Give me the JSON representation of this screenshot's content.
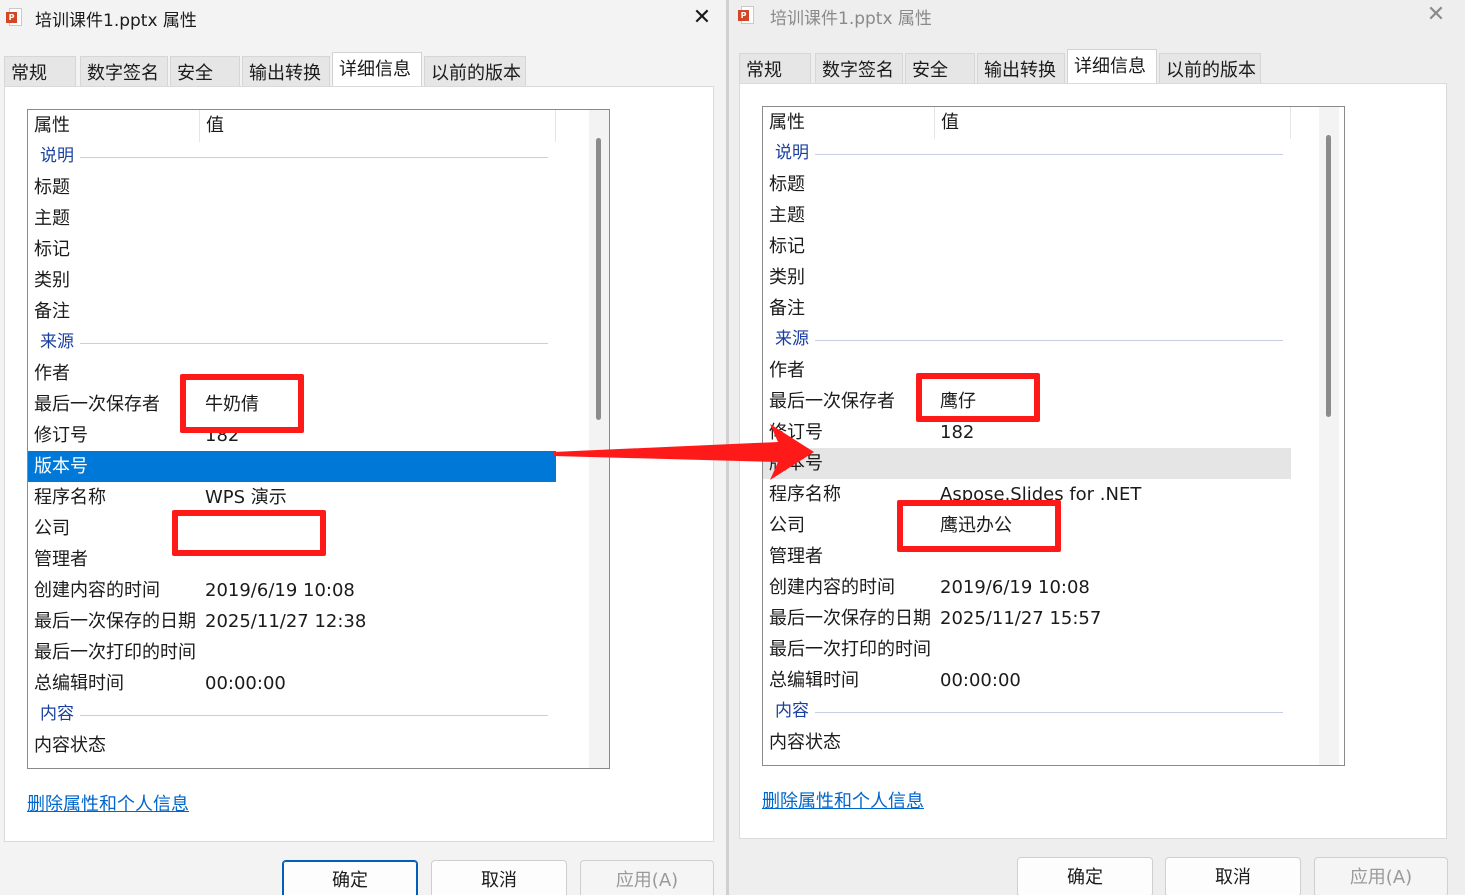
{
  "dialogs": [
    {
      "id": "left",
      "title": "培训课件1.pptx 属性",
      "tabs": [
        "常规",
        "数字签名",
        "安全",
        "输出转换",
        "详细信息",
        "以前的版本"
      ],
      "active_tab": "详细信息",
      "columns": {
        "property": "属性",
        "value": "值"
      },
      "rows": [
        {
          "kind": "group",
          "name": "说明"
        },
        {
          "kind": "prop",
          "name": "标题",
          "value": ""
        },
        {
          "kind": "prop",
          "name": "主题",
          "value": ""
        },
        {
          "kind": "prop",
          "name": "标记",
          "value": ""
        },
        {
          "kind": "prop",
          "name": "类别",
          "value": ""
        },
        {
          "kind": "prop",
          "name": "备注",
          "value": ""
        },
        {
          "kind": "group",
          "name": "来源"
        },
        {
          "kind": "prop",
          "name": "作者",
          "value": ""
        },
        {
          "kind": "prop",
          "name": "最后一次保存者",
          "value": "牛奶倩"
        },
        {
          "kind": "prop",
          "name": "修订号",
          "value": "182"
        },
        {
          "kind": "prop",
          "name": "版本号",
          "value": "",
          "state": "selected"
        },
        {
          "kind": "prop",
          "name": "程序名称",
          "value": "WPS 演示"
        },
        {
          "kind": "prop",
          "name": "公司",
          "value": ""
        },
        {
          "kind": "prop",
          "name": "管理者",
          "value": ""
        },
        {
          "kind": "prop",
          "name": "创建内容的时间",
          "value": "2019/6/19 10:08"
        },
        {
          "kind": "prop",
          "name": "最后一次保存的日期",
          "value": "2025/11/27 12:38"
        },
        {
          "kind": "prop",
          "name": "最后一次打印的时间",
          "value": ""
        },
        {
          "kind": "prop",
          "name": "总编辑时间",
          "value": "00:00:00"
        },
        {
          "kind": "group",
          "name": "内容"
        },
        {
          "kind": "prop",
          "name": "内容状态",
          "value": ""
        }
      ],
      "remove_link": "删除属性和个人信息",
      "buttons": {
        "ok": "确定",
        "cancel": "取消",
        "apply": "应用(A)"
      }
    },
    {
      "id": "right",
      "title": "培训课件1.pptx 属性",
      "tabs": [
        "常规",
        "数字签名",
        "安全",
        "输出转换",
        "详细信息",
        "以前的版本"
      ],
      "active_tab": "详细信息",
      "columns": {
        "property": "属性",
        "value": "值"
      },
      "rows": [
        {
          "kind": "group",
          "name": "说明"
        },
        {
          "kind": "prop",
          "name": "标题",
          "value": ""
        },
        {
          "kind": "prop",
          "name": "主题",
          "value": ""
        },
        {
          "kind": "prop",
          "name": "标记",
          "value": ""
        },
        {
          "kind": "prop",
          "name": "类别",
          "value": ""
        },
        {
          "kind": "prop",
          "name": "备注",
          "value": ""
        },
        {
          "kind": "group",
          "name": "来源"
        },
        {
          "kind": "prop",
          "name": "作者",
          "value": ""
        },
        {
          "kind": "prop",
          "name": "最后一次保存者",
          "value": "鹰仔"
        },
        {
          "kind": "prop",
          "name": "修订号",
          "value": "182"
        },
        {
          "kind": "prop",
          "name": "版本号",
          "value": "",
          "state": "hover"
        },
        {
          "kind": "prop",
          "name": "程序名称",
          "value": "Aspose.Slides for .NET"
        },
        {
          "kind": "prop",
          "name": "公司",
          "value": "鹰迅办公"
        },
        {
          "kind": "prop",
          "name": "管理者",
          "value": ""
        },
        {
          "kind": "prop",
          "name": "创建内容的时间",
          "value": "2019/6/19 10:08"
        },
        {
          "kind": "prop",
          "name": "最后一次保存的日期",
          "value": "2025/11/27 15:57"
        },
        {
          "kind": "prop",
          "name": "最后一次打印的时间",
          "value": ""
        },
        {
          "kind": "prop",
          "name": "总编辑时间",
          "value": "00:00:00"
        },
        {
          "kind": "group",
          "name": "内容"
        },
        {
          "kind": "prop",
          "name": "内容状态",
          "value": ""
        }
      ],
      "remove_link": "删除属性和个人信息",
      "buttons": {
        "ok": "确定",
        "cancel": "取消",
        "apply": "应用(A)"
      }
    }
  ],
  "annotations": {
    "highlight_color": "#ff1a1a",
    "highlight_boxes": [
      "left-last-saved-by",
      "left-company",
      "right-last-saved-by",
      "right-company"
    ],
    "arrow": "left-version-row-to-right-version-row"
  },
  "colors": {
    "selection": "#0078d7",
    "group_header": "#1a3fa0",
    "link": "#0066cc",
    "app_icon": "#d24726"
  }
}
